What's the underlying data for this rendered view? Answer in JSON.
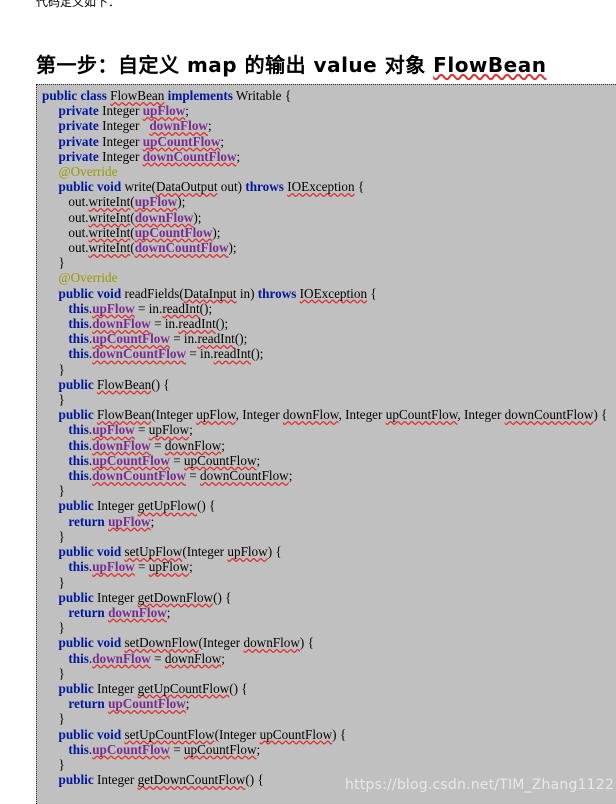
{
  "document": {
    "intro_text": "代码定义如下：",
    "heading_prefix": "第一步：自定义 map 的输出 value 对象 ",
    "heading_highlight": "FlowBean",
    "watermark": "https://blog.csdn.net/TIM_Zhang1122"
  },
  "colors": {
    "page_background": "#ffffff",
    "code_background": "#c0c0c0",
    "keyword": "#00179c",
    "field": "#7a2a8c",
    "annotation": "#9a9a00",
    "plain_text": "#000000",
    "spell_underline": "#e03030",
    "watermark": "#e8e8e8"
  },
  "code": {
    "language": "java",
    "lines": [
      [
        {
          "t": "public class ",
          "c": "kw"
        },
        {
          "t": "FlowBean",
          "c": "pln-sq"
        },
        {
          "t": " ",
          "c": "pln"
        },
        {
          "t": "implements",
          "c": "kw"
        },
        {
          "t": " Writable {",
          "c": "pln"
        }
      ],
      [
        {
          "t": "     ",
          "c": "pln"
        },
        {
          "t": "private",
          "c": "kw"
        },
        {
          "t": " Integer ",
          "c": "pln"
        },
        {
          "t": "upFlow",
          "c": "fld"
        },
        {
          "t": ";",
          "c": "pln"
        }
      ],
      [
        {
          "t": "     ",
          "c": "pln"
        },
        {
          "t": "private",
          "c": "kw"
        },
        {
          "t": " Integer   ",
          "c": "pln"
        },
        {
          "t": "downFlow",
          "c": "fld"
        },
        {
          "t": ";",
          "c": "pln"
        }
      ],
      [
        {
          "t": "     ",
          "c": "pln"
        },
        {
          "t": "private",
          "c": "kw"
        },
        {
          "t": " Integer ",
          "c": "pln"
        },
        {
          "t": "upCountFlow",
          "c": "fld"
        },
        {
          "t": ";",
          "c": "pln"
        }
      ],
      [
        {
          "t": "     ",
          "c": "pln"
        },
        {
          "t": "private",
          "c": "kw"
        },
        {
          "t": " Integer ",
          "c": "pln"
        },
        {
          "t": "downCountFlow",
          "c": "fld"
        },
        {
          "t": ";",
          "c": "pln"
        }
      ],
      [
        {
          "t": "     ",
          "c": "pln"
        },
        {
          "t": "@Override",
          "c": "ann"
        }
      ],
      [
        {
          "t": "     ",
          "c": "pln"
        },
        {
          "t": "public void",
          "c": "kw"
        },
        {
          "t": " write(",
          "c": "pln"
        },
        {
          "t": "DataOutput",
          "c": "pln-sq"
        },
        {
          "t": " out) ",
          "c": "pln"
        },
        {
          "t": "throws",
          "c": "kw"
        },
        {
          "t": " ",
          "c": "pln"
        },
        {
          "t": "IOException",
          "c": "pln-sq"
        },
        {
          "t": " {",
          "c": "pln"
        }
      ],
      [
        {
          "t": "        out.",
          "c": "pln"
        },
        {
          "t": "writeInt",
          "c": "pln-sq"
        },
        {
          "t": "(",
          "c": "pln"
        },
        {
          "t": "upFlow",
          "c": "fld"
        },
        {
          "t": ");",
          "c": "pln"
        }
      ],
      [
        {
          "t": "        out.",
          "c": "pln"
        },
        {
          "t": "writeInt",
          "c": "pln-sq"
        },
        {
          "t": "(",
          "c": "pln"
        },
        {
          "t": "downFlow",
          "c": "fld"
        },
        {
          "t": ");",
          "c": "pln"
        }
      ],
      [
        {
          "t": "        out.",
          "c": "pln"
        },
        {
          "t": "writeInt",
          "c": "pln-sq"
        },
        {
          "t": "(",
          "c": "pln"
        },
        {
          "t": "upCountFlow",
          "c": "fld"
        },
        {
          "t": ");",
          "c": "pln"
        }
      ],
      [
        {
          "t": "        out.",
          "c": "pln"
        },
        {
          "t": "writeInt",
          "c": "pln-sq"
        },
        {
          "t": "(",
          "c": "pln"
        },
        {
          "t": "downCountFlow",
          "c": "fld"
        },
        {
          "t": ");",
          "c": "pln"
        }
      ],
      [
        {
          "t": "     }",
          "c": "pln"
        }
      ],
      [
        {
          "t": "     ",
          "c": "pln"
        },
        {
          "t": "@Override",
          "c": "ann"
        }
      ],
      [
        {
          "t": "     ",
          "c": "pln"
        },
        {
          "t": "public void",
          "c": "kw"
        },
        {
          "t": " readFields(",
          "c": "pln"
        },
        {
          "t": "DataInput",
          "c": "pln-sq"
        },
        {
          "t": " in) ",
          "c": "pln"
        },
        {
          "t": "throws",
          "c": "kw"
        },
        {
          "t": " ",
          "c": "pln"
        },
        {
          "t": "IOException",
          "c": "pln-sq"
        },
        {
          "t": " {",
          "c": "pln"
        }
      ],
      [
        {
          "t": "        ",
          "c": "pln"
        },
        {
          "t": "this",
          "c": "kw"
        },
        {
          "t": ".",
          "c": "pln"
        },
        {
          "t": "upFlow",
          "c": "fld"
        },
        {
          "t": " = in.",
          "c": "pln"
        },
        {
          "t": "readInt",
          "c": "pln-sq"
        },
        {
          "t": "();",
          "c": "pln"
        }
      ],
      [
        {
          "t": "        ",
          "c": "pln"
        },
        {
          "t": "this",
          "c": "kw"
        },
        {
          "t": ".",
          "c": "pln"
        },
        {
          "t": "downFlow",
          "c": "fld"
        },
        {
          "t": " = in.",
          "c": "pln"
        },
        {
          "t": "readInt",
          "c": "pln-sq"
        },
        {
          "t": "();",
          "c": "pln"
        }
      ],
      [
        {
          "t": "        ",
          "c": "pln"
        },
        {
          "t": "this",
          "c": "kw"
        },
        {
          "t": ".",
          "c": "pln"
        },
        {
          "t": "upCountFlow",
          "c": "fld"
        },
        {
          "t": " = in.",
          "c": "pln"
        },
        {
          "t": "readInt",
          "c": "pln-sq"
        },
        {
          "t": "();",
          "c": "pln"
        }
      ],
      [
        {
          "t": "        ",
          "c": "pln"
        },
        {
          "t": "this",
          "c": "kw"
        },
        {
          "t": ".",
          "c": "pln"
        },
        {
          "t": "downCountFlow",
          "c": "fld"
        },
        {
          "t": " = in.",
          "c": "pln"
        },
        {
          "t": "readInt",
          "c": "pln-sq"
        },
        {
          "t": "();",
          "c": "pln"
        }
      ],
      [
        {
          "t": "     }",
          "c": "pln"
        }
      ],
      [
        {
          "t": "     ",
          "c": "pln"
        },
        {
          "t": "public",
          "c": "kw"
        },
        {
          "t": " ",
          "c": "pln"
        },
        {
          "t": "FlowBean",
          "c": "pln-sq"
        },
        {
          "t": "() {",
          "c": "pln"
        }
      ],
      [
        {
          "t": "     }",
          "c": "pln"
        }
      ],
      [
        {
          "t": "     ",
          "c": "pln"
        },
        {
          "t": "public",
          "c": "kw"
        },
        {
          "t": " ",
          "c": "pln"
        },
        {
          "t": "FlowBean",
          "c": "pln-sq"
        },
        {
          "t": "(Integer ",
          "c": "pln"
        },
        {
          "t": "upFlow",
          "c": "pln-sq"
        },
        {
          "t": ", Integer ",
          "c": "pln"
        },
        {
          "t": "downFlow",
          "c": "pln-sq"
        },
        {
          "t": ", Integer ",
          "c": "pln"
        },
        {
          "t": "upCountFlow",
          "c": "pln-sq"
        },
        {
          "t": ", Integer ",
          "c": "pln"
        },
        {
          "t": "downCountFlow",
          "c": "pln-sq"
        },
        {
          "t": ") {",
          "c": "pln"
        }
      ],
      [
        {
          "t": "        ",
          "c": "pln"
        },
        {
          "t": "this",
          "c": "kw"
        },
        {
          "t": ".",
          "c": "pln"
        },
        {
          "t": "upFlow",
          "c": "fld"
        },
        {
          "t": " = ",
          "c": "pln"
        },
        {
          "t": "upFlow",
          "c": "pln-sq"
        },
        {
          "t": ";",
          "c": "pln"
        }
      ],
      [
        {
          "t": "        ",
          "c": "pln"
        },
        {
          "t": "this",
          "c": "kw"
        },
        {
          "t": ".",
          "c": "pln"
        },
        {
          "t": "downFlow",
          "c": "fld"
        },
        {
          "t": " = ",
          "c": "pln"
        },
        {
          "t": "downFlow",
          "c": "pln-sq"
        },
        {
          "t": ";",
          "c": "pln"
        }
      ],
      [
        {
          "t": "        ",
          "c": "pln"
        },
        {
          "t": "this",
          "c": "kw"
        },
        {
          "t": ".",
          "c": "pln"
        },
        {
          "t": "upCountFlow",
          "c": "fld"
        },
        {
          "t": " = ",
          "c": "pln"
        },
        {
          "t": "upCountFlow",
          "c": "pln-sq"
        },
        {
          "t": ";",
          "c": "pln"
        }
      ],
      [
        {
          "t": "        ",
          "c": "pln"
        },
        {
          "t": "this",
          "c": "kw"
        },
        {
          "t": ".",
          "c": "pln"
        },
        {
          "t": "downCountFlow",
          "c": "fld"
        },
        {
          "t": " = ",
          "c": "pln"
        },
        {
          "t": "downCountFlow",
          "c": "pln-sq"
        },
        {
          "t": ";",
          "c": "pln"
        }
      ],
      [
        {
          "t": "     }",
          "c": "pln"
        }
      ],
      [
        {
          "t": "     ",
          "c": "pln"
        },
        {
          "t": "public",
          "c": "kw"
        },
        {
          "t": " Integer ",
          "c": "pln"
        },
        {
          "t": "getUpFlow",
          "c": "pln-sq"
        },
        {
          "t": "() {",
          "c": "pln"
        }
      ],
      [
        {
          "t": "        ",
          "c": "pln"
        },
        {
          "t": "return",
          "c": "kw"
        },
        {
          "t": " ",
          "c": "pln"
        },
        {
          "t": "upFlow",
          "c": "fld"
        },
        {
          "t": ";",
          "c": "pln"
        }
      ],
      [
        {
          "t": "     }",
          "c": "pln"
        }
      ],
      [
        {
          "t": "     ",
          "c": "pln"
        },
        {
          "t": "public void",
          "c": "kw"
        },
        {
          "t": " ",
          "c": "pln"
        },
        {
          "t": "setUpFlow",
          "c": "pln-sq"
        },
        {
          "t": "(Integer ",
          "c": "pln"
        },
        {
          "t": "upFlow",
          "c": "pln-sq"
        },
        {
          "t": ") {",
          "c": "pln"
        }
      ],
      [
        {
          "t": "        ",
          "c": "pln"
        },
        {
          "t": "this",
          "c": "kw"
        },
        {
          "t": ".",
          "c": "pln"
        },
        {
          "t": "upFlow",
          "c": "fld"
        },
        {
          "t": " = ",
          "c": "pln"
        },
        {
          "t": "upFlow",
          "c": "pln-sq"
        },
        {
          "t": ";",
          "c": "pln"
        }
      ],
      [
        {
          "t": "     }",
          "c": "pln"
        }
      ],
      [
        {
          "t": "     ",
          "c": "pln"
        },
        {
          "t": "public",
          "c": "kw"
        },
        {
          "t": " Integer ",
          "c": "pln"
        },
        {
          "t": "getDownFlow",
          "c": "pln-sq"
        },
        {
          "t": "() {",
          "c": "pln"
        }
      ],
      [
        {
          "t": "        ",
          "c": "pln"
        },
        {
          "t": "return",
          "c": "kw"
        },
        {
          "t": " ",
          "c": "pln"
        },
        {
          "t": "downFlow",
          "c": "fld"
        },
        {
          "t": ";",
          "c": "pln"
        }
      ],
      [
        {
          "t": "     }",
          "c": "pln"
        }
      ],
      [
        {
          "t": "     ",
          "c": "pln"
        },
        {
          "t": "public void",
          "c": "kw"
        },
        {
          "t": " ",
          "c": "pln"
        },
        {
          "t": "setDownFlow",
          "c": "pln-sq"
        },
        {
          "t": "(Integer ",
          "c": "pln"
        },
        {
          "t": "downFlow",
          "c": "pln-sq"
        },
        {
          "t": ") {",
          "c": "pln"
        }
      ],
      [
        {
          "t": "        ",
          "c": "pln"
        },
        {
          "t": "this",
          "c": "kw"
        },
        {
          "t": ".",
          "c": "pln"
        },
        {
          "t": "downFlow",
          "c": "fld"
        },
        {
          "t": " = ",
          "c": "pln"
        },
        {
          "t": "downFlow",
          "c": "pln-sq"
        },
        {
          "t": ";",
          "c": "pln"
        }
      ],
      [
        {
          "t": "     }",
          "c": "pln"
        }
      ],
      [
        {
          "t": "     ",
          "c": "pln"
        },
        {
          "t": "public",
          "c": "kw"
        },
        {
          "t": " Integer ",
          "c": "pln"
        },
        {
          "t": "getUpCountFlow",
          "c": "pln-sq"
        },
        {
          "t": "() {",
          "c": "pln"
        }
      ],
      [
        {
          "t": "        ",
          "c": "pln"
        },
        {
          "t": "return",
          "c": "kw"
        },
        {
          "t": " ",
          "c": "pln"
        },
        {
          "t": "upCountFlow",
          "c": "fld"
        },
        {
          "t": ";",
          "c": "pln"
        }
      ],
      [
        {
          "t": "     }",
          "c": "pln"
        }
      ],
      [
        {
          "t": "     ",
          "c": "pln"
        },
        {
          "t": "public void",
          "c": "kw"
        },
        {
          "t": " ",
          "c": "pln"
        },
        {
          "t": "setUpCountFlow",
          "c": "pln-sq"
        },
        {
          "t": "(Integer ",
          "c": "pln"
        },
        {
          "t": "upCountFlow",
          "c": "pln-sq"
        },
        {
          "t": ") {",
          "c": "pln"
        }
      ],
      [
        {
          "t": "        ",
          "c": "pln"
        },
        {
          "t": "this",
          "c": "kw"
        },
        {
          "t": ".",
          "c": "pln"
        },
        {
          "t": "upCountFlow",
          "c": "fld"
        },
        {
          "t": " = ",
          "c": "pln"
        },
        {
          "t": "upCountFlow",
          "c": "pln-sq"
        },
        {
          "t": ";",
          "c": "pln"
        }
      ],
      [
        {
          "t": "     }",
          "c": "pln"
        }
      ],
      [
        {
          "t": "     ",
          "c": "pln"
        },
        {
          "t": "public",
          "c": "kw"
        },
        {
          "t": " Integer ",
          "c": "pln"
        },
        {
          "t": "getDownCountFlow",
          "c": "pln-sq"
        },
        {
          "t": "() {",
          "c": "pln"
        }
      ]
    ]
  }
}
